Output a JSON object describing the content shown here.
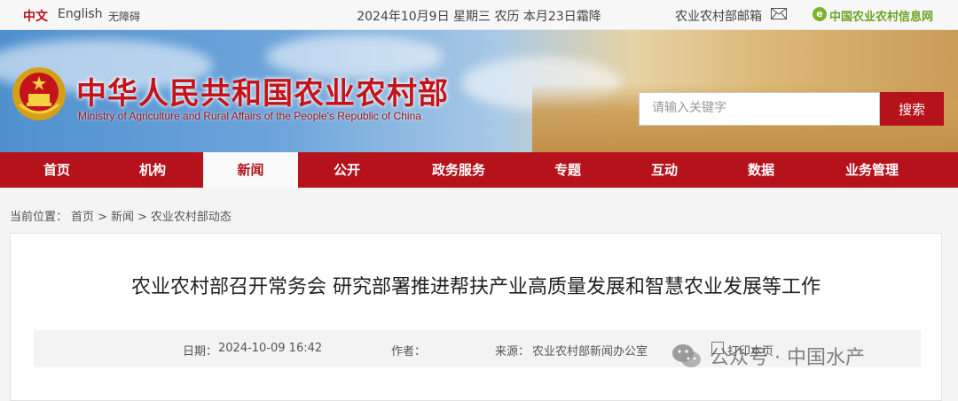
{
  "topbar": {
    "lang_zh": "中文",
    "lang_en": "English",
    "accessibility": "无障碍",
    "date": "2024年10月9日 星期三 农历 本月23日霜降",
    "mail_label": "农业农村部邮箱",
    "site_label": "中国农业农村信息网",
    "site_icon_char": "e"
  },
  "header": {
    "title": "中华人民共和国农业农村部",
    "subtitle": "Ministry of Agriculture and Rural Affairs of the People's Republic of China"
  },
  "search": {
    "placeholder": "请输入关键字",
    "value": "",
    "button_label": "搜索"
  },
  "nav": {
    "items": [
      {
        "label": "首页"
      },
      {
        "label": "机构"
      },
      {
        "label": "新闻",
        "active": true
      },
      {
        "label": "公开"
      },
      {
        "label": "政务服务"
      },
      {
        "label": "专题"
      },
      {
        "label": "互动"
      },
      {
        "label": "数据"
      },
      {
        "label": "业务管理"
      }
    ]
  },
  "breadcrumb": {
    "prefix": "当前位置：",
    "items": [
      "首页",
      "新闻",
      "农业农村部动态"
    ],
    "separator": ">"
  },
  "article": {
    "title": "农业农村部召开常务会 研究部署推进帮扶产业高质量发展和智慧农业发展等工作",
    "date_label": "日期：",
    "date_value": "2024-10-09 16:42",
    "author_label": "作者：",
    "author_value": "",
    "source_label": "来源：",
    "source_value": "农业农村部新闻办公室",
    "print_label": "打印本页"
  },
  "watermark": {
    "text": "公众号 · 中国水产"
  },
  "colors": {
    "brand_red": "#b5121b",
    "site_green": "#6aa321"
  }
}
